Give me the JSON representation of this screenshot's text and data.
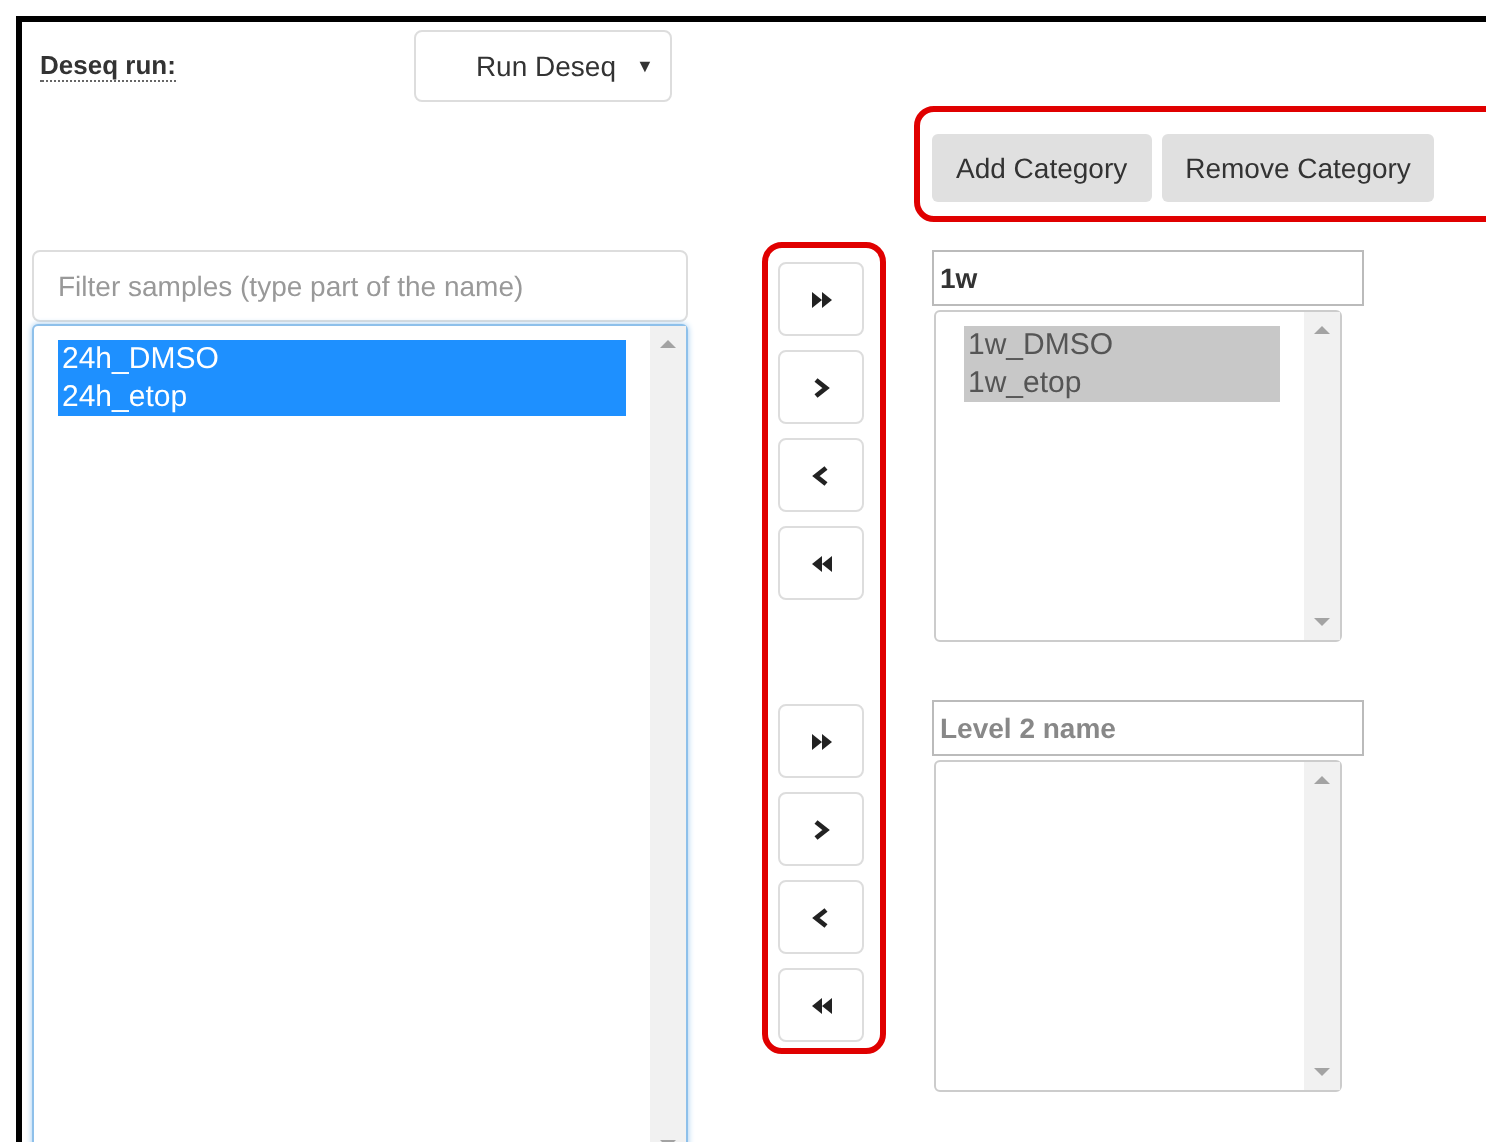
{
  "deseq_run": {
    "label": "Deseq run:",
    "select": {
      "value": "Run Deseq",
      "caret": "▼"
    }
  },
  "category_buttons": [
    {
      "label": "Add Category"
    },
    {
      "label": "Remove Category"
    }
  ],
  "filter": {
    "placeholder": "Filter samples (type part of the name)"
  },
  "samples_list": {
    "focused": true,
    "items": [
      {
        "label": "24h_DMSO",
        "selected": true
      },
      {
        "label": "24h_etop",
        "selected": true
      }
    ]
  },
  "move_groups": [
    {
      "buttons": [
        {
          "kind": "all-right"
        },
        {
          "kind": "right"
        },
        {
          "kind": "left"
        },
        {
          "kind": "all-left"
        }
      ]
    },
    {
      "buttons": [
        {
          "kind": "all-right"
        },
        {
          "kind": "right"
        },
        {
          "kind": "left"
        },
        {
          "kind": "all-left"
        }
      ]
    }
  ],
  "categories": [
    {
      "name": "1w",
      "focused": false,
      "items": [
        {
          "label": "1w_DMSO",
          "selected": true
        },
        {
          "label": "1w_etop",
          "selected": true
        }
      ]
    },
    {
      "placeholder": "Level 2 name",
      "focused": false
    }
  ]
}
